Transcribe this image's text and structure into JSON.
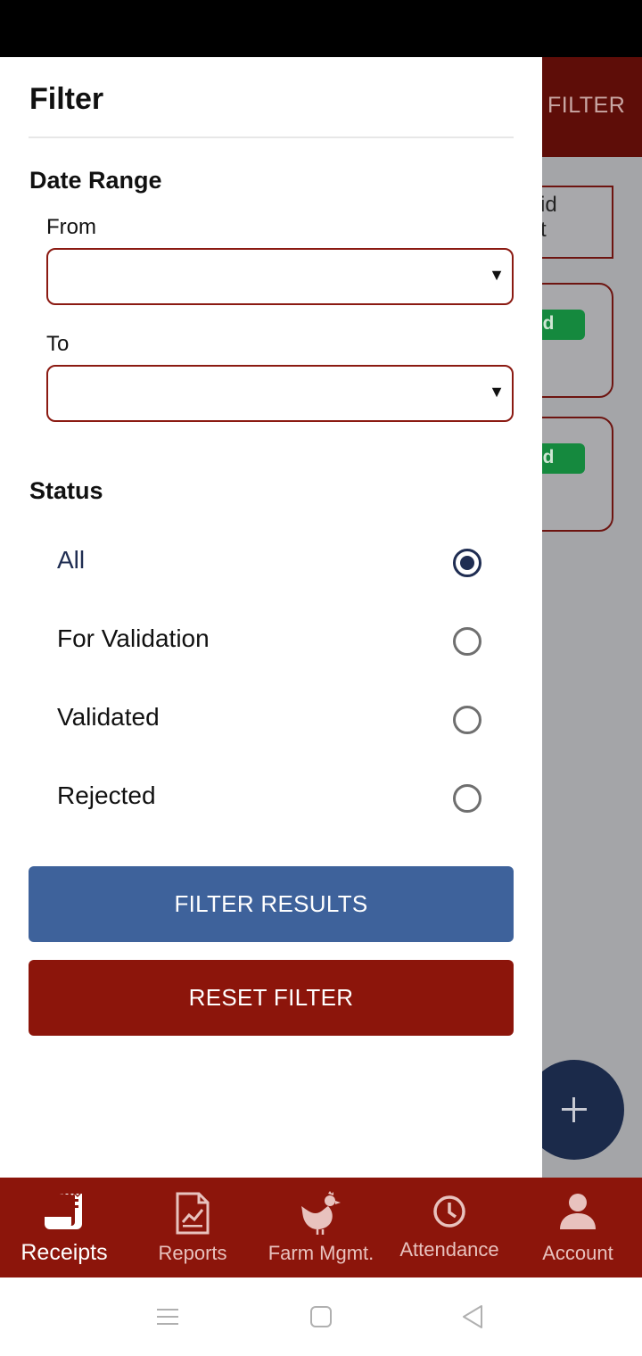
{
  "background": {
    "header_action": "FILTER",
    "cards": [
      {
        "text_line1": "id",
        "text_line2": "t"
      },
      {
        "badge": "ted"
      },
      {
        "badge": "ted"
      }
    ],
    "fab_icon": "plus-icon"
  },
  "drawer": {
    "title": "Filter",
    "date_range": {
      "title": "Date Range",
      "from_label": "From",
      "from_value": "",
      "to_label": "To",
      "to_value": ""
    },
    "status": {
      "title": "Status",
      "options": [
        {
          "label": "All",
          "selected": true
        },
        {
          "label": "For Validation",
          "selected": false
        },
        {
          "label": "Validated",
          "selected": false
        },
        {
          "label": "Rejected",
          "selected": false
        }
      ]
    },
    "filter_button": "FILTER RESULTS",
    "reset_button": "RESET FILTER"
  },
  "bottom_nav": {
    "items": [
      {
        "label": "Receipts",
        "icon": "receipt-icon",
        "active": true
      },
      {
        "label": "Reports",
        "icon": "report-chart-icon",
        "active": false
      },
      {
        "label": "Farm Mgmt.",
        "icon": "chicken-icon",
        "active": false
      },
      {
        "label": "Attendance",
        "icon": "clock-icon",
        "active": false
      },
      {
        "label": "Account",
        "icon": "user-icon",
        "active": false
      }
    ]
  },
  "colors": {
    "primary_red": "#8c150b",
    "header_dim_red": "#5e0d08",
    "filter_blue": "#3e629b",
    "radio_selected": "#1f2d52",
    "badge_green": "#15893e"
  }
}
